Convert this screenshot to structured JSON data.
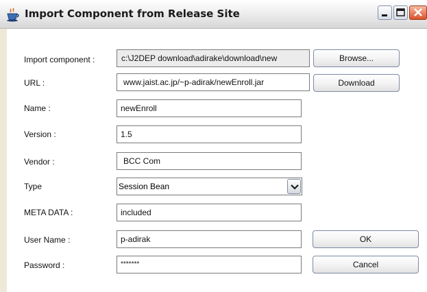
{
  "window": {
    "title": "Import Component from Release Site",
    "icon": "java-cup-icon"
  },
  "titlebar_buttons": {
    "minimize_icon": "minimize-icon",
    "maximize_icon": "maximize-icon",
    "close_icon": "close-icon"
  },
  "form": {
    "import_component": {
      "label": "Import component :",
      "value": "c:\\J2DEP download\\adirake\\download\\new"
    },
    "url": {
      "label": "URL :",
      "value": "www.jaist.ac.jp/~p-adirak/newEnroll.jar"
    },
    "name": {
      "label": "Name :",
      "value": "newEnroll"
    },
    "version": {
      "label": "Version :",
      "value": "1.5"
    },
    "vendor": {
      "label": "Vendor :",
      "value": "BCC Com"
    },
    "type": {
      "label": "Type",
      "value": "Session Bean"
    },
    "meta_data": {
      "label": "META DATA :",
      "value": "included"
    },
    "user_name": {
      "label": "User Name :",
      "value": "p-adirak"
    },
    "password": {
      "label": "Password :",
      "value": "*******"
    }
  },
  "buttons": {
    "browse": "Browse...",
    "download": "Download",
    "ok": "OK",
    "cancel": "Cancel"
  }
}
